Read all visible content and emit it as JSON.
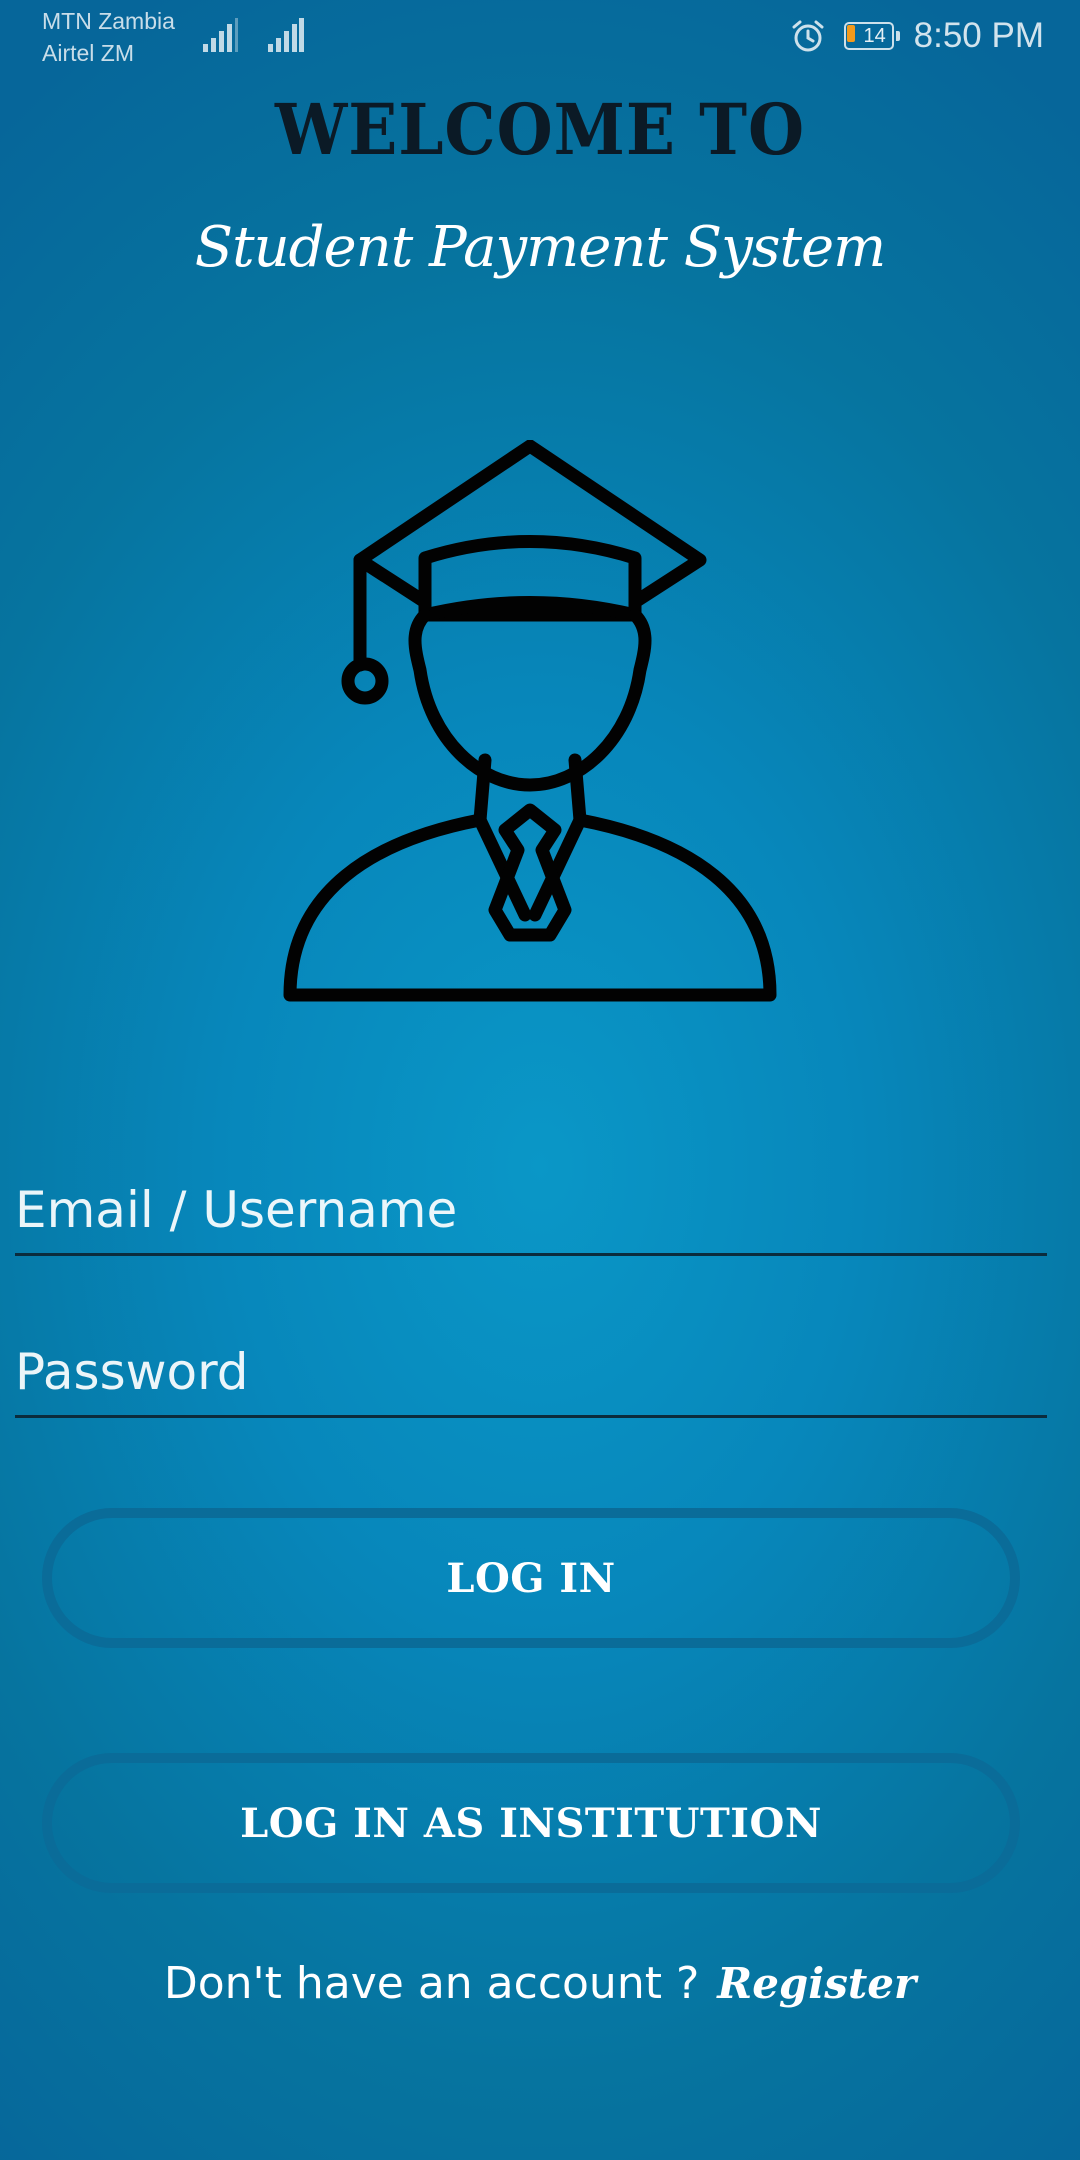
{
  "status_bar": {
    "carrier_1": "MTN Zambia",
    "carrier_2": "Airtel ZM",
    "battery_level": "14",
    "battery_fraction": 0.14,
    "time": "8:50 PM",
    "icons": [
      "signal-icon",
      "signal-icon",
      "alarm-icon",
      "battery-icon"
    ]
  },
  "header": {
    "welcome": "WELCOME TO",
    "app_name": "Student Payment System"
  },
  "hero": {
    "icon": "graduate-student-icon"
  },
  "form": {
    "email_placeholder": "Email / Username",
    "password_placeholder": "Password",
    "email_value": "",
    "password_value": ""
  },
  "actions": {
    "login_label": "LOG IN",
    "institution_login_label": "LOG IN AS INSTITUTION"
  },
  "footer": {
    "prompt": "Don't have an account ?",
    "register_label": "Register"
  },
  "colors": {
    "background_center": "#0a97c7",
    "background_edge": "#06669a",
    "title_text": "#0b1a26",
    "button_outline": "#0a6c99",
    "battery_fill": "#f39a1c"
  }
}
